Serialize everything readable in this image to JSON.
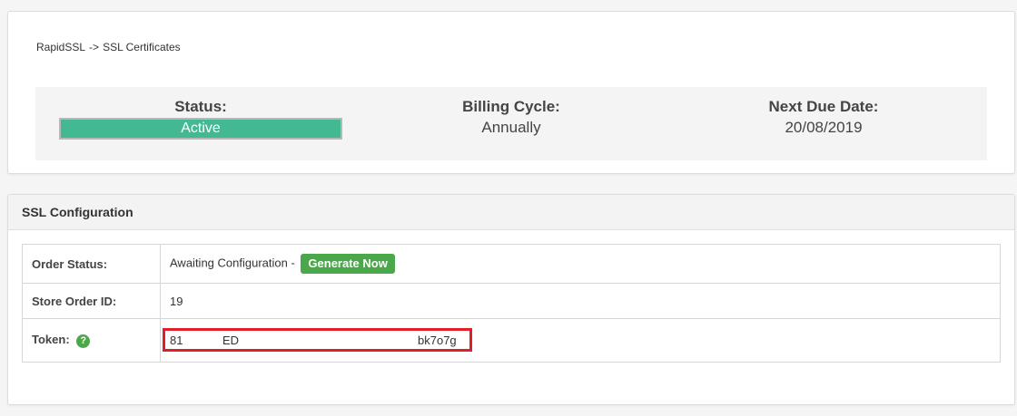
{
  "breadcrumb": {
    "parent": "RapidSSL",
    "separator": "->",
    "current": "SSL Certificates"
  },
  "summary": {
    "status_label": "Status:",
    "status_value": "Active",
    "billing_label": "Billing Cycle:",
    "billing_value": "Annually",
    "due_label": "Next Due Date:",
    "due_value": "20/08/2019"
  },
  "config": {
    "title": "SSL Configuration",
    "rows": [
      {
        "label": "Order Status:",
        "value": "Awaiting Configuration -",
        "button": "Generate Now"
      },
      {
        "label": "Store Order ID:",
        "value": "19"
      },
      {
        "label": "Token:",
        "token_parts": [
          "81",
          "ED",
          "bk7o7g"
        ]
      }
    ],
    "help_icon_glyph": "?"
  },
  "colors": {
    "status_active": "#43b993",
    "button_green": "#4aa84a",
    "highlight_red": "#e02028"
  }
}
